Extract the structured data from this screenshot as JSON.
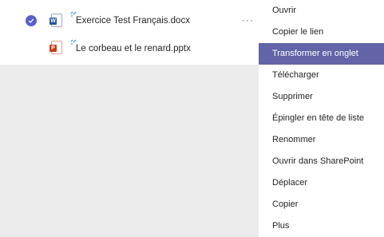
{
  "files": [
    {
      "name": "Exercice Test Français.docx",
      "type": "word",
      "type_letter": "W",
      "selected": true,
      "more": "···"
    },
    {
      "name": "Le corbeau et le renard.pptx",
      "type": "powerpoint",
      "type_letter": "P",
      "selected": false
    }
  ],
  "context_menu": {
    "items": [
      {
        "label": "Ouvrir"
      },
      {
        "label": "Copier le lien"
      },
      {
        "label": "Transformer en onglet",
        "active": true
      },
      {
        "label": "Télécharger"
      },
      {
        "label": "Supprimer"
      },
      {
        "label": "Épingler en tête de liste"
      },
      {
        "label": "Renommer"
      },
      {
        "label": "Ouvrir dans SharePoint"
      },
      {
        "label": "Déplacer"
      },
      {
        "label": "Copier"
      },
      {
        "label": "Plus"
      }
    ]
  },
  "colors": {
    "accent": "#6264a7",
    "checkmark": "#5b5fc7",
    "word": "#2b579a",
    "powerpoint": "#c43e1c",
    "background": "#ebebeb"
  },
  "icons": {
    "selected": "check-circle-icon",
    "word": "word-file-icon",
    "powerpoint": "powerpoint-file-icon",
    "new": "new-file-sparkle-icon",
    "more": "more-options-icon"
  }
}
